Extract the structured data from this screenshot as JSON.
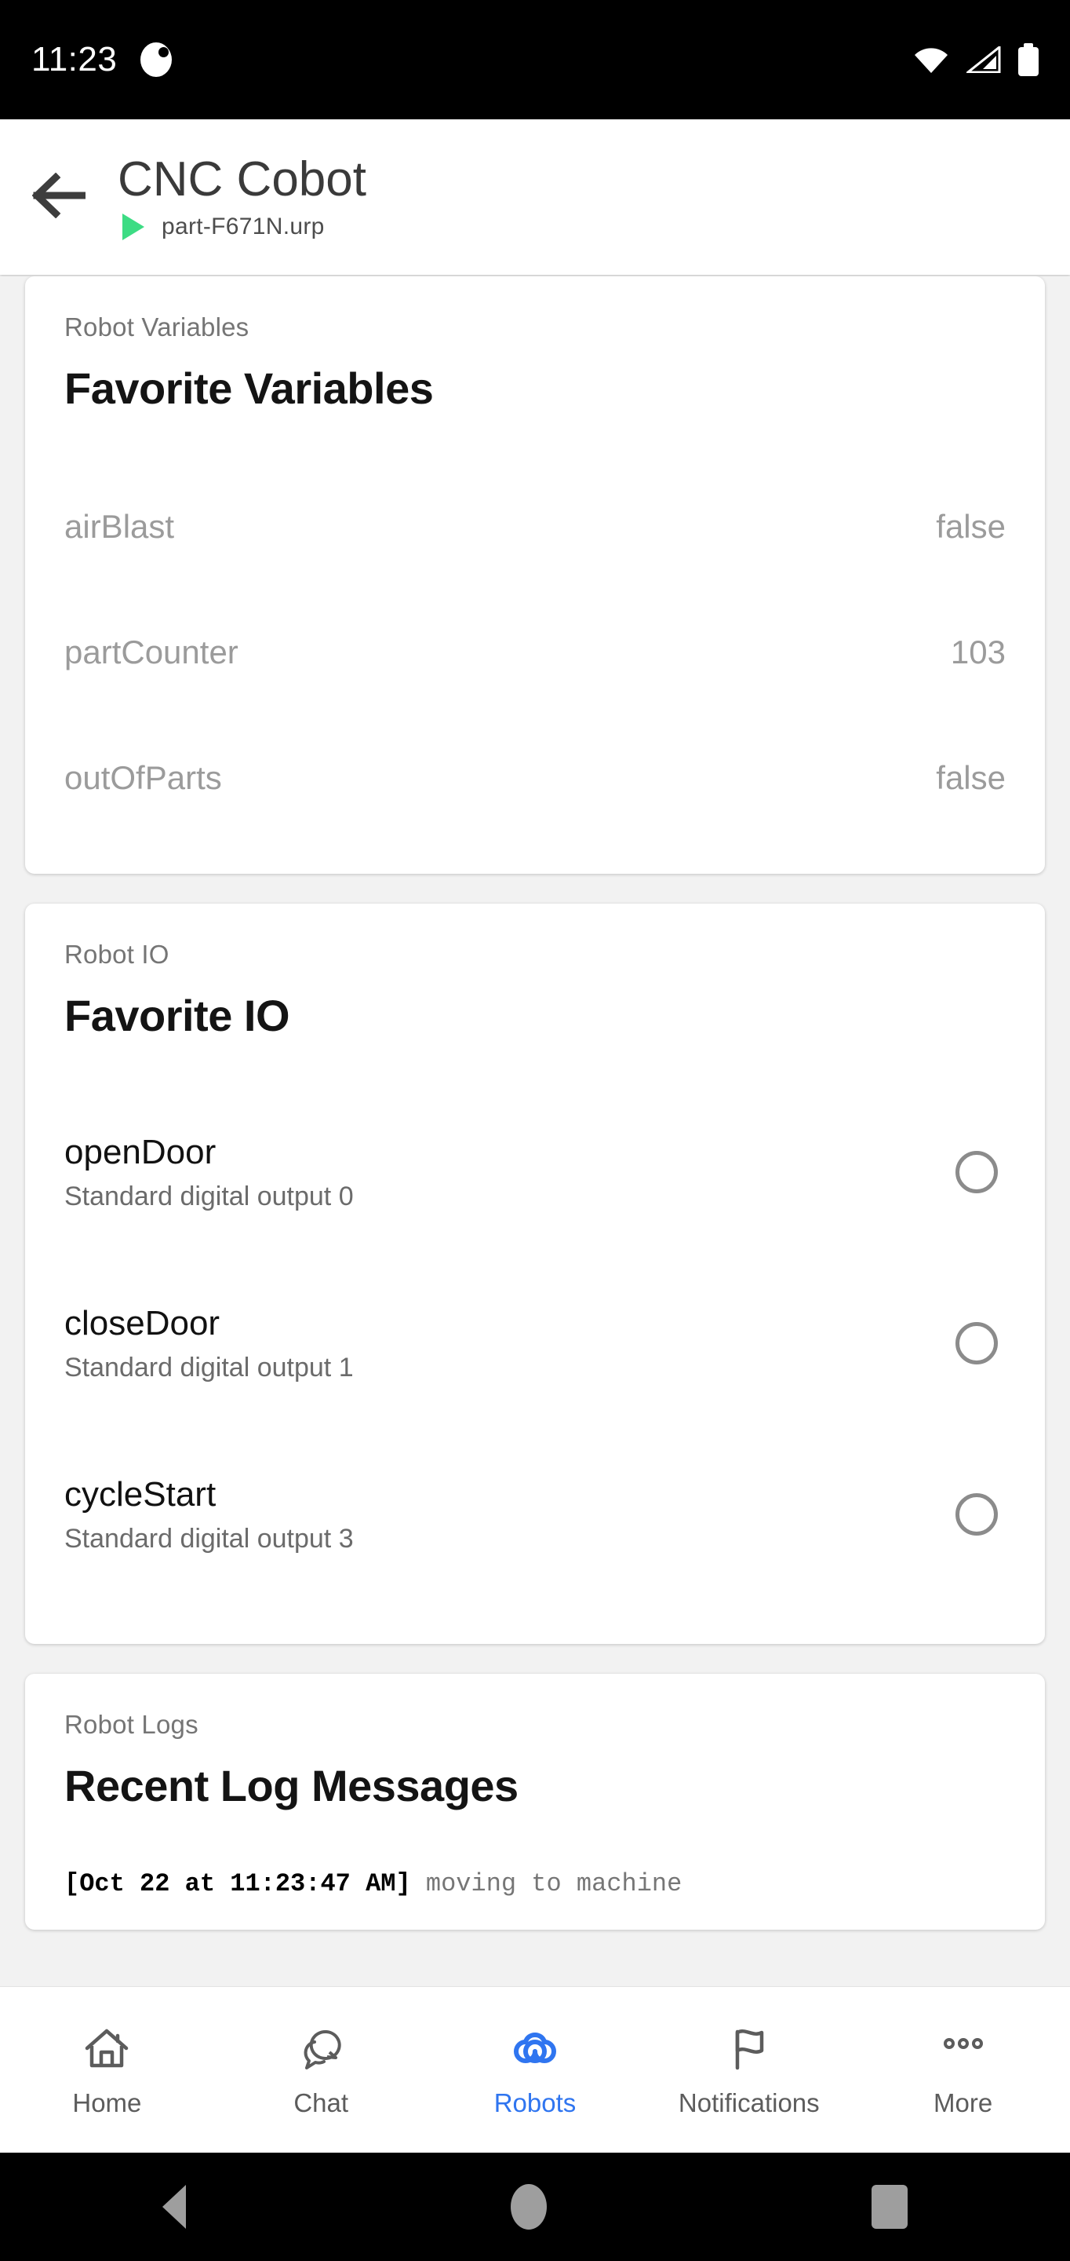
{
  "status_bar": {
    "time": "11:23",
    "app_icon": "app-notification-icon",
    "wifi_icon": "wifi-icon",
    "cellular_icon": "cellular-signal-icon",
    "battery_icon": "battery-icon"
  },
  "app_bar": {
    "back_icon": "back-arrow-icon",
    "title": "CNC Cobot",
    "program_status_icon": "play-icon",
    "program_name": "part-F671N.urp",
    "accent_green": "#3ddc84"
  },
  "cards": {
    "variables": {
      "eyebrow": "Robot Variables",
      "title": "Favorite Variables",
      "rows": [
        {
          "name": "airBlast",
          "value": "false"
        },
        {
          "name": "partCounter",
          "value": "103"
        },
        {
          "name": "outOfParts",
          "value": "false"
        }
      ]
    },
    "io": {
      "eyebrow": "Robot IO",
      "title": "Favorite IO",
      "rows": [
        {
          "name": "openDoor",
          "desc": "Standard digital output 0",
          "state": "off"
        },
        {
          "name": "closeDoor",
          "desc": "Standard digital output 1",
          "state": "off"
        },
        {
          "name": "cycleStart",
          "desc": "Standard digital output 3",
          "state": "off"
        }
      ]
    },
    "logs": {
      "eyebrow": "Robot Logs",
      "title": "Recent Log Messages",
      "entries": [
        {
          "timestamp": "[Oct 22 at 11:23:47 AM]",
          "message": " moving to machine"
        }
      ]
    }
  },
  "bottom_nav": {
    "active_color": "#2f75f0",
    "items": [
      {
        "label": "Home",
        "icon": "home-icon",
        "active": false
      },
      {
        "label": "Chat",
        "icon": "chat-bubble-icon",
        "active": false
      },
      {
        "label": "Robots",
        "icon": "robots-infinity-icon",
        "active": true
      },
      {
        "label": "Notifications",
        "icon": "flag-icon",
        "active": false
      },
      {
        "label": "More",
        "icon": "more-dots-icon",
        "active": false
      }
    ]
  },
  "android_nav": {
    "back": "android-back-icon",
    "home": "android-home-icon",
    "recents": "android-recents-icon"
  }
}
